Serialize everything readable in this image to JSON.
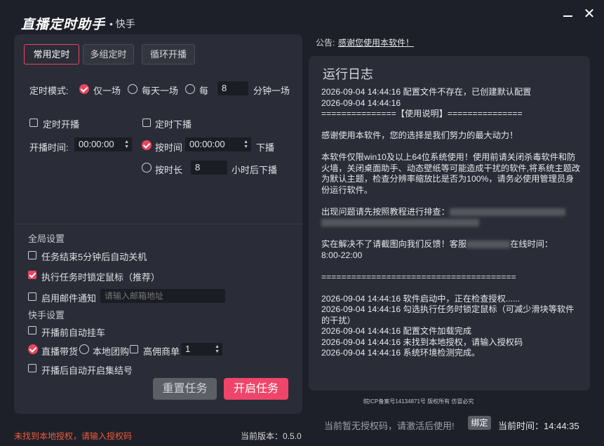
{
  "app": {
    "title": "直播定时助手",
    "subtitle": "• 快手"
  },
  "tabs": [
    {
      "label": "常用定时",
      "active": true
    },
    {
      "label": "多组定时",
      "active": false
    },
    {
      "label": "循环开播",
      "active": false
    }
  ],
  "timer_mode": {
    "label": "定时模式:",
    "options": [
      "仅一场",
      "每天一场",
      "每"
    ],
    "selected": "仅一场",
    "interval_value": "8",
    "interval_unit": "分钟一场"
  },
  "start": {
    "checkbox_label": "定时开播",
    "checked": false,
    "time_label": "开播时间:",
    "time_value": "00:00:00"
  },
  "stop": {
    "checkbox_label": "定时下播",
    "checked": false,
    "by_time_label": "按时间",
    "by_time_selected": true,
    "time_value": "00:00:00",
    "by_time_suffix": "下播",
    "by_duration_label": "按时长",
    "duration_value": "8",
    "duration_suffix": "小时后下播"
  },
  "global_settings": {
    "title": "全局设置",
    "auto_shutdown": {
      "label": "任务结束5分钟后自动关机",
      "checked": false
    },
    "lock_mouse": {
      "label": "执行任务时锁定鼠标（推荐）",
      "checked": true
    },
    "email": {
      "label": "启用邮件通知",
      "checked": false,
      "placeholder": "请输入邮箱地址"
    }
  },
  "kuaishou_settings": {
    "title": "快手设置",
    "auto_hang": {
      "label": "开播前自动挂车",
      "checked": false
    },
    "live_goods": {
      "label": "直播带货",
      "selected": true
    },
    "local_group": {
      "label": "本地团购",
      "selected": false
    },
    "high_commission": {
      "label": "高佣商单",
      "checked": false
    },
    "commission_value": "1",
    "auto_gather": {
      "label": "开播后自动开启集结号",
      "checked": false
    }
  },
  "buttons": {
    "reset": "重置任务",
    "start": "开启任务"
  },
  "notice": {
    "label": "公告:",
    "link": "感谢您使用本软件！"
  },
  "log": {
    "title": "运行日志",
    "lines": [
      "2026-09-04 14:44:16 配置文件不存在，已创建默认配置",
      "2026-09-04 14:44:16",
      "===============【使用说明】===============",
      "",
      "感谢使用本软件，您的选择是我们努力的最大动力！",
      "",
      "本软件仅限win10及以上64位系统使用！使用前请关闭杀毒软件和防火墙，关闭桌面助手、动态壁纸等可能造成干扰的软件,将系统主题改为默认主题，检查分辨率缩放比是否为100%，请务必使用管理员身份运行软件。",
      "",
      "出现问题请先按照教程进行排查：",
      "",
      "",
      "实在解决不了请截图向我们反馈！客服",
      "8:00-22:00",
      "",
      "=======================================",
      "",
      "2026-09-04 14:44:16 软件启动中，正在检查授权......",
      "2026-09-04 14:44:16 勾选执行任务时锁定鼠标（可减少滑块等软件的干扰）",
      "2026-09-04 14:44:16 配置文件加载完成",
      "2026-09-04 14:44:16 未找到本地授权，请输入授权码",
      "2026-09-04 14:44:16 系统环境检测完成。"
    ],
    "service_suffix": "在线时间："
  },
  "footer": {
    "icp": "皖ICP备案号14134871号 版权所有 仿冒必究",
    "hint": "当前暂无授权码，请激活后使用!",
    "bind": "绑定",
    "time_label": "当前时间：",
    "time_value": "14:44:35",
    "auth_warning": "未找到本地授权，请输入授权码",
    "version_label": "当前版本：",
    "version_value": "0.5.0"
  },
  "colors": {
    "accent": "#e8455f",
    "start_button": "#f0456a",
    "warning": "#ef5a3c",
    "background": "#1e2029",
    "panel": "#2a2d38"
  }
}
